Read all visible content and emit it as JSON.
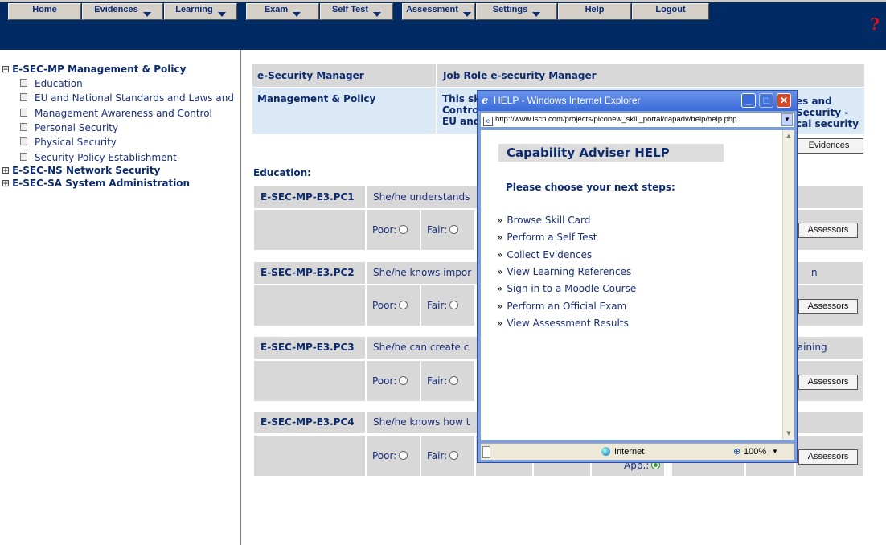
{
  "nav": {
    "items": [
      {
        "label": "Home",
        "dropdown": false
      },
      {
        "label": "Evidences",
        "dropdown": true
      },
      {
        "label": "Learning",
        "dropdown": true
      },
      {
        "label": "Exam",
        "dropdown": true
      },
      {
        "label": "Self Test",
        "dropdown": true
      },
      {
        "label": "Assessment",
        "dropdown": true
      },
      {
        "label": "Settings",
        "dropdown": true
      },
      {
        "label": "Help",
        "dropdown": false
      },
      {
        "label": "Logout",
        "dropdown": false
      }
    ],
    "help_symbol": "?"
  },
  "sidebar": {
    "roots": [
      {
        "toggle": "⊟",
        "label": "E-SEC-MP Management & Policy"
      },
      {
        "toggle": "⊞",
        "label": "E-SEC-NS Network Security"
      },
      {
        "toggle": "⊞",
        "label": "E-SEC-SA System Administration"
      }
    ],
    "items": [
      {
        "label": "Education"
      },
      {
        "label": "EU and National Standards and Laws and"
      },
      {
        "label": "Management Awareness and Control"
      },
      {
        "label": "Personal Security"
      },
      {
        "label": "Physical Security"
      },
      {
        "label": "Security Policy Establishment"
      }
    ]
  },
  "main": {
    "header_left_1": "e-Security Manager",
    "header_right_1": "Job Role e-security Manager",
    "header_left_2": "Management & Policy",
    "header_right_2_a": "This sk",
    "header_right_2_b": "Contro",
    "header_right_2_c": "EU and",
    "header_right_2_tail_a": "es and",
    "header_right_2_tail_b": "Security -",
    "header_right_2_tail_c": "cal security",
    "evidences_button": "Evidences",
    "section_title": "Education:",
    "rows": [
      {
        "code": "E-SEC-MP-E3.PC1",
        "text": "She/he understands",
        "tail": "",
        "poor": "Poor:",
        "fair": "Fair:",
        "assessors": "Assessors"
      },
      {
        "code": "E-SEC-MP-E3.PC2",
        "text": "She/he knows impor",
        "tail": "n",
        "poor": "Poor:",
        "fair": "Fair:",
        "assessors": "Assessors"
      },
      {
        "code": "E-SEC-MP-E3.PC3",
        "text": "She/he can create c",
        "tail": "l training",
        "poor": "Poor:",
        "fair": "Fair:",
        "assessors": "Assessors"
      },
      {
        "code": "E-SEC-MP-E3.PC4",
        "text": "She/he knows how t",
        "tail": "",
        "poor": "Poor:",
        "fair": "Fair:",
        "assessors": "Assessors",
        "app_label": "App.:"
      }
    ]
  },
  "popup": {
    "title": "HELP - Windows Internet Explorer",
    "url": "http://www.iscn.com/projects/piconew_skill_portal/capadv/help/help.php",
    "heading": "Capability Adviser HELP",
    "subheading": "Please choose your next steps:",
    "links": [
      "Browse Skill Card",
      "Perform a Self Test",
      "Collect Evidences",
      "View Learning References",
      "Sign in to a Moodle Course",
      "Perform an Official Exam",
      "View Assessment Results"
    ],
    "status_zone": "Internet",
    "zoom": "100%"
  }
}
